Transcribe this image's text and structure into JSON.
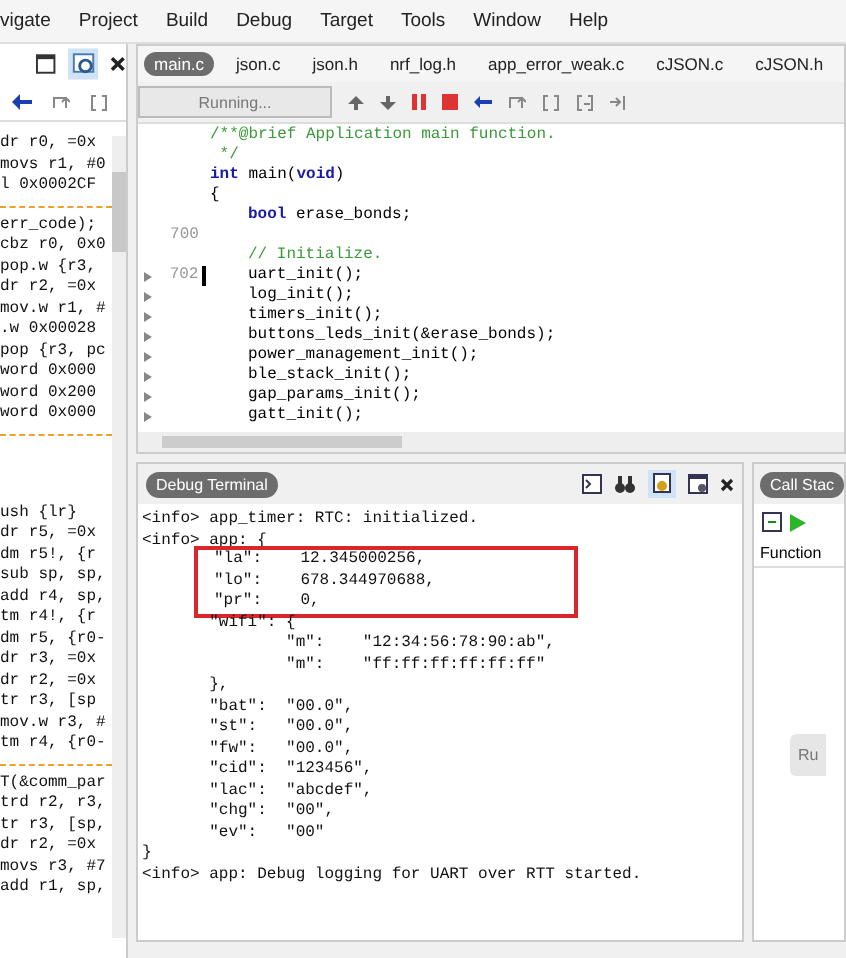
{
  "menu": [
    "vigate",
    "Project",
    "Build",
    "Debug",
    "Target",
    "Tools",
    "Window",
    "Help"
  ],
  "disassembly": {
    "top_sections": [
      {
        "separator_after": true,
        "lines": [
          "dr r0, =0x",
          "movs r1, #0",
          "l 0x0002CF"
        ]
      },
      {
        "separator_after": true,
        "lines": [
          "err_code);",
          "cbz r0, 0x0",
          "pop.w {r3, ",
          "dr r2, =0x",
          "mov.w r1, #",
          ".w 0x00028",
          "pop {r3, pc",
          "word 0x000",
          "word 0x200",
          "word 0x000"
        ]
      }
    ],
    "bottom_sections": [
      {
        "separator_after": true,
        "lines": [
          "ush {lr}",
          "dr r5, =0x",
          "dm r5!, {r",
          "sub sp, sp,",
          "add r4, sp,",
          "tm r4!, {r",
          "dm r5, {r0-",
          "dr r3, =0x",
          "dr r2, =0x",
          "tr r3, [sp",
          "mov.w r3, #",
          "tm r4, {r0-"
        ]
      },
      {
        "separator_after": false,
        "lines": [
          "T(&comm_par",
          "trd r2, r3,",
          "tr r3, [sp,",
          "dr r2, =0x",
          "movs r3, #7",
          "add r1, sp,"
        ]
      }
    ]
  },
  "editor": {
    "tabs": [
      {
        "label": "main.c",
        "selected": true
      },
      {
        "label": "json.c",
        "selected": false
      },
      {
        "label": "json.h",
        "selected": false
      },
      {
        "label": "nrf_log.h",
        "selected": false
      },
      {
        "label": "app_error_weak.c",
        "selected": false
      },
      {
        "label": "cJSON.c",
        "selected": false
      },
      {
        "label": "cJSON.h",
        "selected": false
      }
    ],
    "run_status": "Running...",
    "lines": [
      {
        "marker": false,
        "cursor": false,
        "indent": false,
        "tokens": [
          {
            "kind": "comment",
            "text": "/**@brief Application main function."
          }
        ]
      },
      {
        "marker": false,
        "cursor": false,
        "indent": false,
        "tokens": [
          {
            "kind": "comment",
            "text": " */"
          }
        ]
      },
      {
        "marker": false,
        "cursor": false,
        "indent": false,
        "tokens": [
          {
            "kind": "keyword",
            "text": "int"
          },
          {
            "kind": "plain",
            "text": " main("
          },
          {
            "kind": "keyword",
            "text": "void"
          },
          {
            "kind": "plain",
            "text": ")"
          }
        ]
      },
      {
        "marker": false,
        "cursor": false,
        "indent": false,
        "tokens": [
          {
            "kind": "plain",
            "text": "{"
          }
        ]
      },
      {
        "marker": false,
        "cursor": false,
        "indent": true,
        "tokens": [
          {
            "kind": "keyword",
            "text": "bool"
          },
          {
            "kind": "plain",
            "text": " erase_bonds;"
          }
        ]
      },
      {
        "number": "700",
        "marker": false,
        "cursor": false
      },
      {
        "marker": false,
        "cursor": false,
        "indent": true,
        "tokens": [
          {
            "kind": "comment",
            "text": "// Initialize."
          }
        ]
      },
      {
        "number": "702",
        "marker": true,
        "cursor": true,
        "indent": true,
        "tokens": [
          {
            "kind": "plain",
            "text": "uart_init();"
          }
        ]
      },
      {
        "marker": true,
        "cursor": false,
        "indent": true,
        "tokens": [
          {
            "kind": "plain",
            "text": "log_init();"
          }
        ]
      },
      {
        "marker": true,
        "cursor": false,
        "indent": true,
        "tokens": [
          {
            "kind": "plain",
            "text": "timers_init();"
          }
        ]
      },
      {
        "marker": true,
        "cursor": false,
        "indent": true,
        "tokens": [
          {
            "kind": "plain",
            "text": "buttons_leds_init(&erase_bonds);"
          }
        ]
      },
      {
        "marker": true,
        "cursor": false,
        "indent": true,
        "tokens": [
          {
            "kind": "plain",
            "text": "power_management_init();"
          }
        ]
      },
      {
        "marker": true,
        "cursor": false,
        "indent": true,
        "tokens": [
          {
            "kind": "plain",
            "text": "ble_stack_init();"
          }
        ]
      },
      {
        "marker": true,
        "cursor": false,
        "indent": true,
        "tokens": [
          {
            "kind": "plain",
            "text": "gap_params_init();"
          }
        ]
      },
      {
        "marker": true,
        "cursor": false,
        "indent": true,
        "tokens": [
          {
            "kind": "plain",
            "text": "gatt_init();"
          }
        ]
      }
    ]
  },
  "terminal": {
    "title": "Debug Terminal",
    "blocks": [
      {
        "kind": "plain",
        "lines": [
          "<info> app_timer: RTC: initialized.",
          "<info> app: {"
        ]
      },
      {
        "kind": "highlight",
        "lines": [
          "\"la\":    12.345000256,",
          "\"lo\":    678.344970688,",
          "\"pr\":    0,"
        ]
      },
      {
        "kind": "plain",
        "lines": [
          "       \"wifi\": {",
          "               \"m\":    \"12:34:56:78:90:ab\",",
          "               \"m\":    \"ff:ff:ff:ff:ff:ff\"",
          "       },",
          "       \"bat\":  \"00.0\",",
          "       \"st\":   \"00.0\",",
          "       \"fw\":   \"00.0\",",
          "       \"cid\":  \"123456\",",
          "       \"lac\":  \"abcdef\",",
          "       \"chg\":  \"00\",",
          "       \"ev\":   \"00\"",
          "}",
          "<info> app: Debug logging for UART over RTT started."
        ]
      }
    ]
  },
  "call_stack": {
    "title": "Call Stac",
    "column": "Function",
    "button": "Ru"
  }
}
